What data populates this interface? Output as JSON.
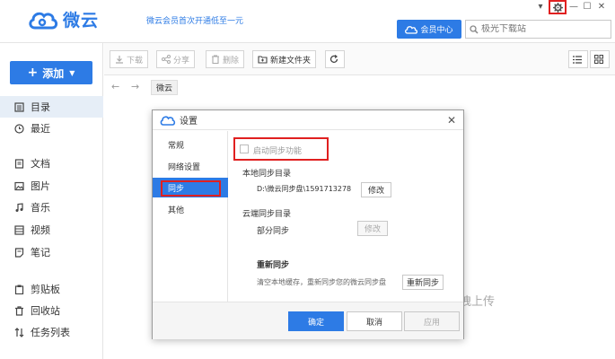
{
  "app": {
    "name": "微云",
    "promo": "微云会员首次开通低至一元",
    "vip_label": "会员中心",
    "search_placeholder": "极光下载站"
  },
  "window_controls": [
    "⚙",
    "—",
    "☐",
    "✕"
  ],
  "sidebar": {
    "add_label": "添加",
    "items": [
      {
        "label": "目录",
        "icon": "directory-icon",
        "active": true
      },
      {
        "label": "最近",
        "icon": "clock-icon"
      },
      {
        "label": "文档",
        "icon": "document-icon"
      },
      {
        "label": "图片",
        "icon": "image-icon"
      },
      {
        "label": "音乐",
        "icon": "music-icon"
      },
      {
        "label": "视频",
        "icon": "video-icon"
      },
      {
        "label": "笔记",
        "icon": "note-icon"
      },
      {
        "label": "剪贴板",
        "icon": "clipboard-icon"
      },
      {
        "label": "回收站",
        "icon": "trash-icon"
      },
      {
        "label": "任务列表",
        "icon": "transfer-icon"
      }
    ]
  },
  "toolbar": {
    "download": "下载",
    "share": "分享",
    "delete": "删除",
    "new_folder": "新建文件夹"
  },
  "breadcrumb": "微云",
  "background_hint": "拽上传",
  "dialog": {
    "title": "设置",
    "nav": [
      "常规",
      "网络设置",
      "同步",
      "其他"
    ],
    "active_nav": "同步",
    "enable_sync": "启动同步功能",
    "local_dir_label": "本地同步目录",
    "local_dir_path": "D:\\微云同步盘\\1591713278",
    "modify_label": "修改",
    "cloud_dir_label": "云端同步目录",
    "partial_sync": "部分同步",
    "resync_title": "重新同步",
    "resync_desc": "清空本地缓存，重新同步您的微云同步盘",
    "resync_button": "重新同步",
    "ok": "确定",
    "cancel": "取消",
    "apply": "应用"
  },
  "colors": {
    "accent": "#2d7be5",
    "highlight": "#e02020"
  }
}
